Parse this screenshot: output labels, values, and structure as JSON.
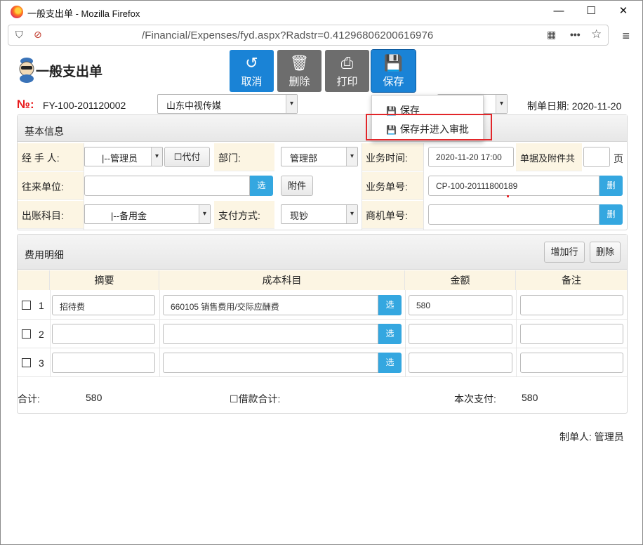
{
  "window": {
    "title": "一般支出单 - Mozilla Firefox",
    "url": "/Financial/Expenses/fyd.aspx?Radstr=0.41296806200616976",
    "min": "—",
    "max": "☐",
    "close": "✕"
  },
  "header": {
    "page_title": "一般支出单",
    "doc_mark": "№:",
    "doc_no": "FY-100-201120002",
    "company": "山东中视传媒",
    "date_label": "制单日期:",
    "date_value": "2020-11-20"
  },
  "toolbar": {
    "cancel": "取消",
    "delete": "删除",
    "print": "打印",
    "save": "保存"
  },
  "save_menu": {
    "save": "保存",
    "save_and_approve": "保存并进入审批"
  },
  "basic": {
    "title": "基本信息",
    "handler_label": "经 手 人:",
    "handler_value": "|--管理员",
    "proxy_pay": "代付",
    "dept_label": "部门:",
    "dept_value": "管理部",
    "biz_time_label": "业务时间:",
    "biz_time_value": "2020-11-20 17:00",
    "attach_label": "单据及附件共",
    "attach_unit": "页",
    "partner_label": "往来单位:",
    "pick": "选",
    "attach_btn": "附件",
    "biz_no_label": "业务单号:",
    "biz_no_value": "CP-100-20111800189",
    "del": "删",
    "account_label": "出账科目:",
    "account_value": "|--备用金",
    "pay_label": "支付方式:",
    "pay_value": "现钞",
    "opp_label": "商机单号:"
  },
  "detail": {
    "title": "费用明细",
    "add_row": "增加行",
    "delete": "删除",
    "columns": [
      "摘要",
      "成本科目",
      "金额",
      "备注"
    ],
    "rows": [
      {
        "no": "1",
        "summary": "招待费",
        "cost": "660105 销售费用/交际应酬费",
        "amount": "580",
        "note": ""
      },
      {
        "no": "2",
        "summary": "",
        "cost": "",
        "amount": "",
        "note": ""
      },
      {
        "no": "3",
        "summary": "",
        "cost": "",
        "amount": "",
        "note": ""
      }
    ],
    "total_label": "合计:",
    "total_value": "580",
    "loan_label": "借款合计:",
    "pay_now_label": "本次支付:",
    "pay_now_value": "580"
  },
  "footer": {
    "maker_label": "制单人:",
    "maker_value": "管理员"
  },
  "colors": {
    "blue_button": "#1a83d6",
    "gray_button": "#6d6d6d",
    "pick_button": "#34a7e0",
    "label_bg": "#fcf5e3",
    "highlight": "#e2262a"
  }
}
